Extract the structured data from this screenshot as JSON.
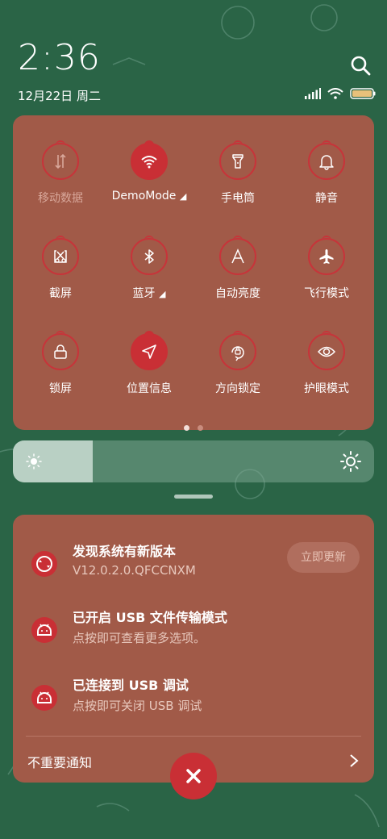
{
  "status": {
    "time": "2:36",
    "date": "12月22日 周二"
  },
  "quick_settings": {
    "tiles": [
      {
        "label": "移动数据",
        "icon": "mobile-data-icon",
        "state": "disabled"
      },
      {
        "label": "DemoMode",
        "icon": "wifi-icon",
        "state": "active",
        "expand": "◢"
      },
      {
        "label": "手电筒",
        "icon": "flashlight-icon",
        "state": "off"
      },
      {
        "label": "静音",
        "icon": "bell-icon",
        "state": "off"
      },
      {
        "label": "截屏",
        "icon": "screenshot-icon",
        "state": "off"
      },
      {
        "label": "蓝牙",
        "icon": "bluetooth-icon",
        "state": "off",
        "expand": "◢"
      },
      {
        "label": "自动亮度",
        "icon": "auto-brightness-icon",
        "state": "off"
      },
      {
        "label": "飞行模式",
        "icon": "airplane-icon",
        "state": "off"
      },
      {
        "label": "锁屏",
        "icon": "lock-icon",
        "state": "off"
      },
      {
        "label": "位置信息",
        "icon": "location-icon",
        "state": "active"
      },
      {
        "label": "方向锁定",
        "icon": "rotation-lock-icon",
        "state": "off"
      },
      {
        "label": "护眼模式",
        "icon": "eye-icon",
        "state": "off"
      }
    ],
    "page_count": 2,
    "current_page": 1
  },
  "brightness": {
    "level": 0.22
  },
  "notifications": [
    {
      "title": "发现系统有新版本",
      "text": "V12.0.2.0.QFCCNXM",
      "icon": "system-update-icon",
      "action": "立即更新"
    },
    {
      "title": "已开启 USB 文件传输模式",
      "text": "点按即可查看更多选项。",
      "icon": "android-icon"
    },
    {
      "title": "已连接到 USB 调试",
      "text": "点按即可关闭 USB 调试",
      "icon": "android-icon"
    }
  ],
  "unimportant_label": "不重要通知",
  "colors": {
    "accent": "#c92f35",
    "panel": "#a15a48",
    "background": "#2a6446"
  }
}
